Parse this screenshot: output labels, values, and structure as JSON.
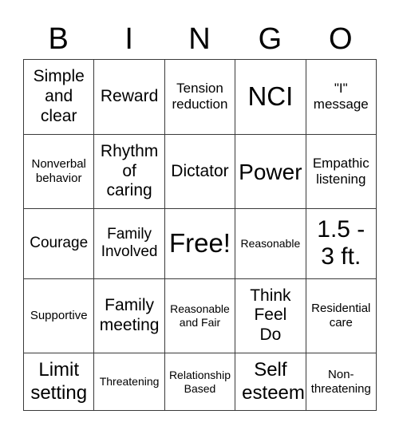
{
  "header": {
    "letters": [
      "B",
      "I",
      "N",
      "G",
      "O"
    ]
  },
  "board": {
    "rows": [
      [
        "Simple and clear",
        "Reward",
        "Tension reduction",
        "NCI",
        "\"I\" message"
      ],
      [
        "Nonverbal behavior",
        "Rhythm of caring",
        "Dictator",
        "Power",
        "Empathic listening"
      ],
      [
        "Courage",
        "Family Involved",
        "Free!",
        "Reasonable",
        "1.5 - 3 ft."
      ],
      [
        "Supportive",
        "Family meeting",
        "Reasonable and Fair",
        "Think Feel Do",
        "Residential care"
      ],
      [
        "Limit setting",
        "Threatening",
        "Relationship Based",
        "Self esteem",
        "Non-threatening"
      ]
    ]
  }
}
